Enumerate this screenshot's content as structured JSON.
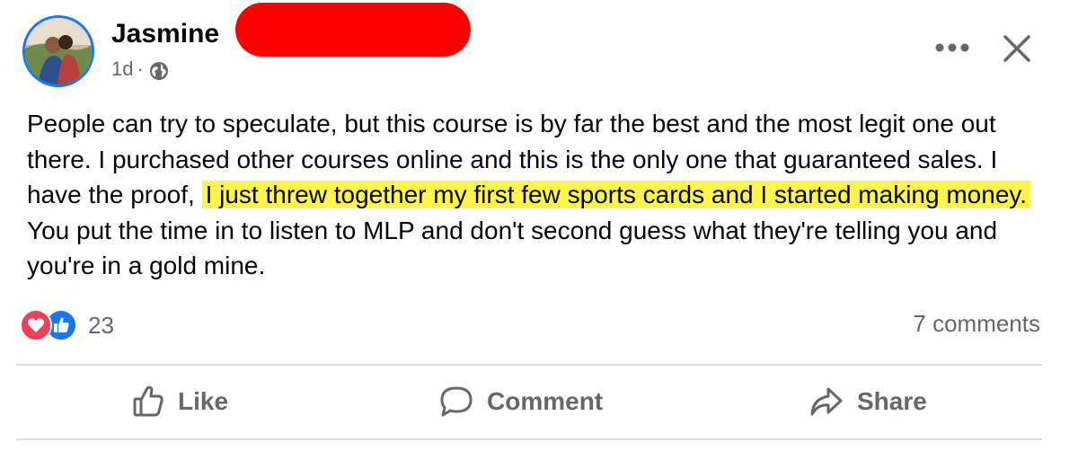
{
  "post": {
    "author": "Jasmine",
    "timestamp": "1d",
    "separator": "·",
    "privacy_icon": "globe-icon",
    "text_before": "People can try to speculate, but this course is by far the best and the most legit one out there. I purchased other courses online and this is the only one that guaranteed sales. I have the proof, ",
    "text_highlight": "I just threw together my first few sports cards and I started making money.",
    "text_after": " You put the time in to listen to MLP and don't second guess what they're telling you and you're in a gold mine.",
    "highlight_color": "#fdf54a",
    "redaction_color": "#ff0000"
  },
  "header_actions": {
    "more_icon": "more-horizontal-icon",
    "close_icon": "close-icon"
  },
  "engagement": {
    "reaction_icons": [
      "love-reaction-icon",
      "like-reaction-icon"
    ],
    "reaction_count": "23",
    "comments_label": "7 comments"
  },
  "actions": {
    "like_label": "Like",
    "comment_label": "Comment",
    "share_label": "Share"
  },
  "colors": {
    "accent": "#1877f2",
    "love": "#f33e58",
    "secondary_text": "#65676b",
    "divider": "#dadde1"
  }
}
